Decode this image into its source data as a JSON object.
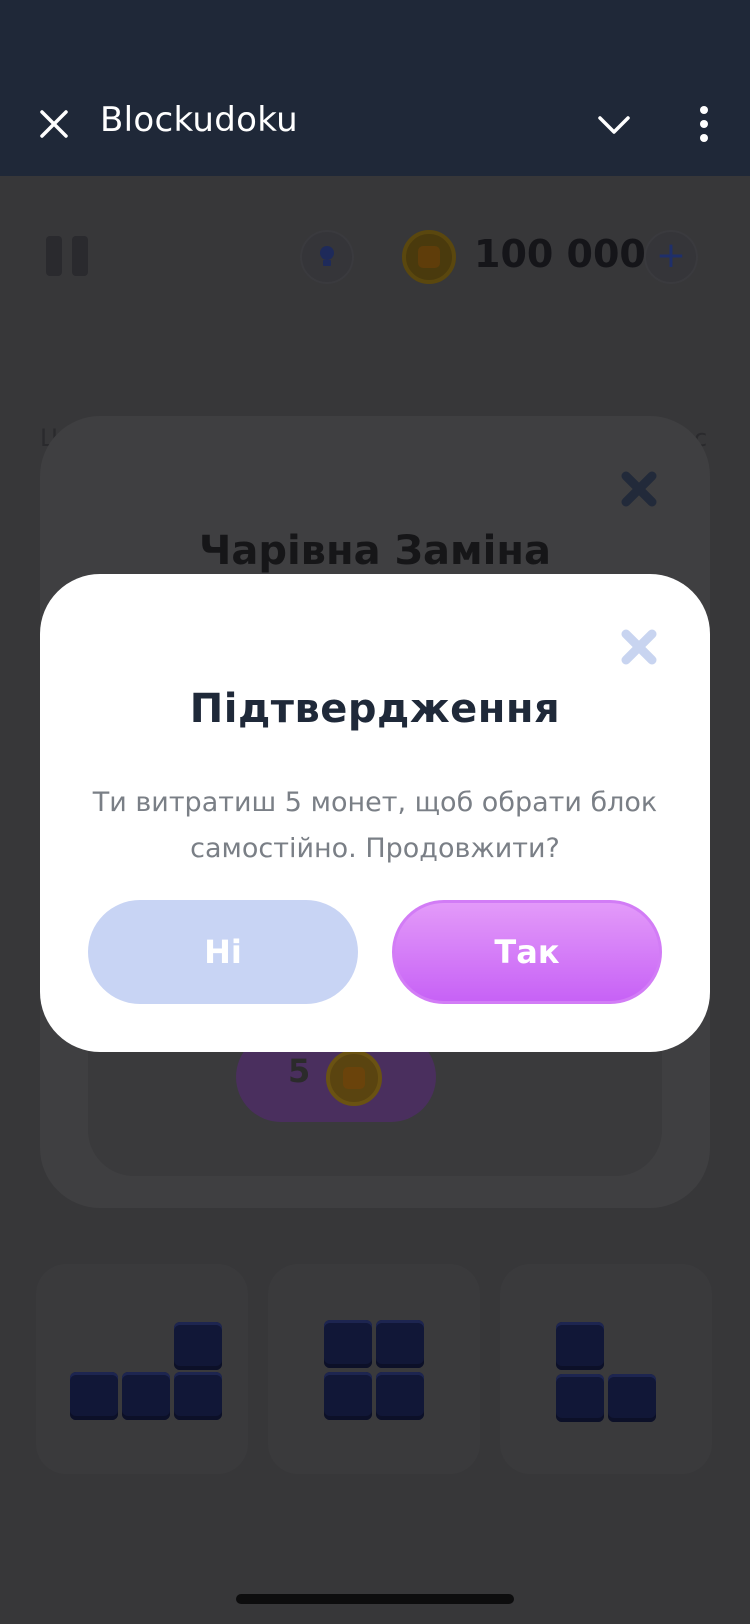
{
  "appbar": {
    "title": "Blockudoku",
    "close_icon": "close-icon",
    "expand_icon": "chevron-down-icon",
    "menu_icon": "more-vert-icon"
  },
  "game": {
    "coins": "100 000",
    "pause_icon": "pause-icon",
    "hint_icon": "lightbulb-icon",
    "coin_icon": "coin-icon",
    "add_coins_label": "+",
    "side_left": "Ц",
    "side_right": "с"
  },
  "background_dialog": {
    "title": "Чарівна Заміна",
    "cost": "5",
    "close_icon": "close-icon"
  },
  "confirm_dialog": {
    "title": "Підтвердження",
    "message": "Ти витратиш 5 монет, щоб обрати блок самостійно. Продовжити?",
    "no_label": "Ні",
    "yes_label": "Так",
    "close_icon": "close-icon"
  },
  "colors": {
    "appbar_bg": "#1f2838",
    "overlay_bg": "#373739",
    "no_button": "#c8d4f4",
    "yes_button": "#d27cf6",
    "title_text": "#1f2939",
    "body_text": "#7a7f86"
  }
}
